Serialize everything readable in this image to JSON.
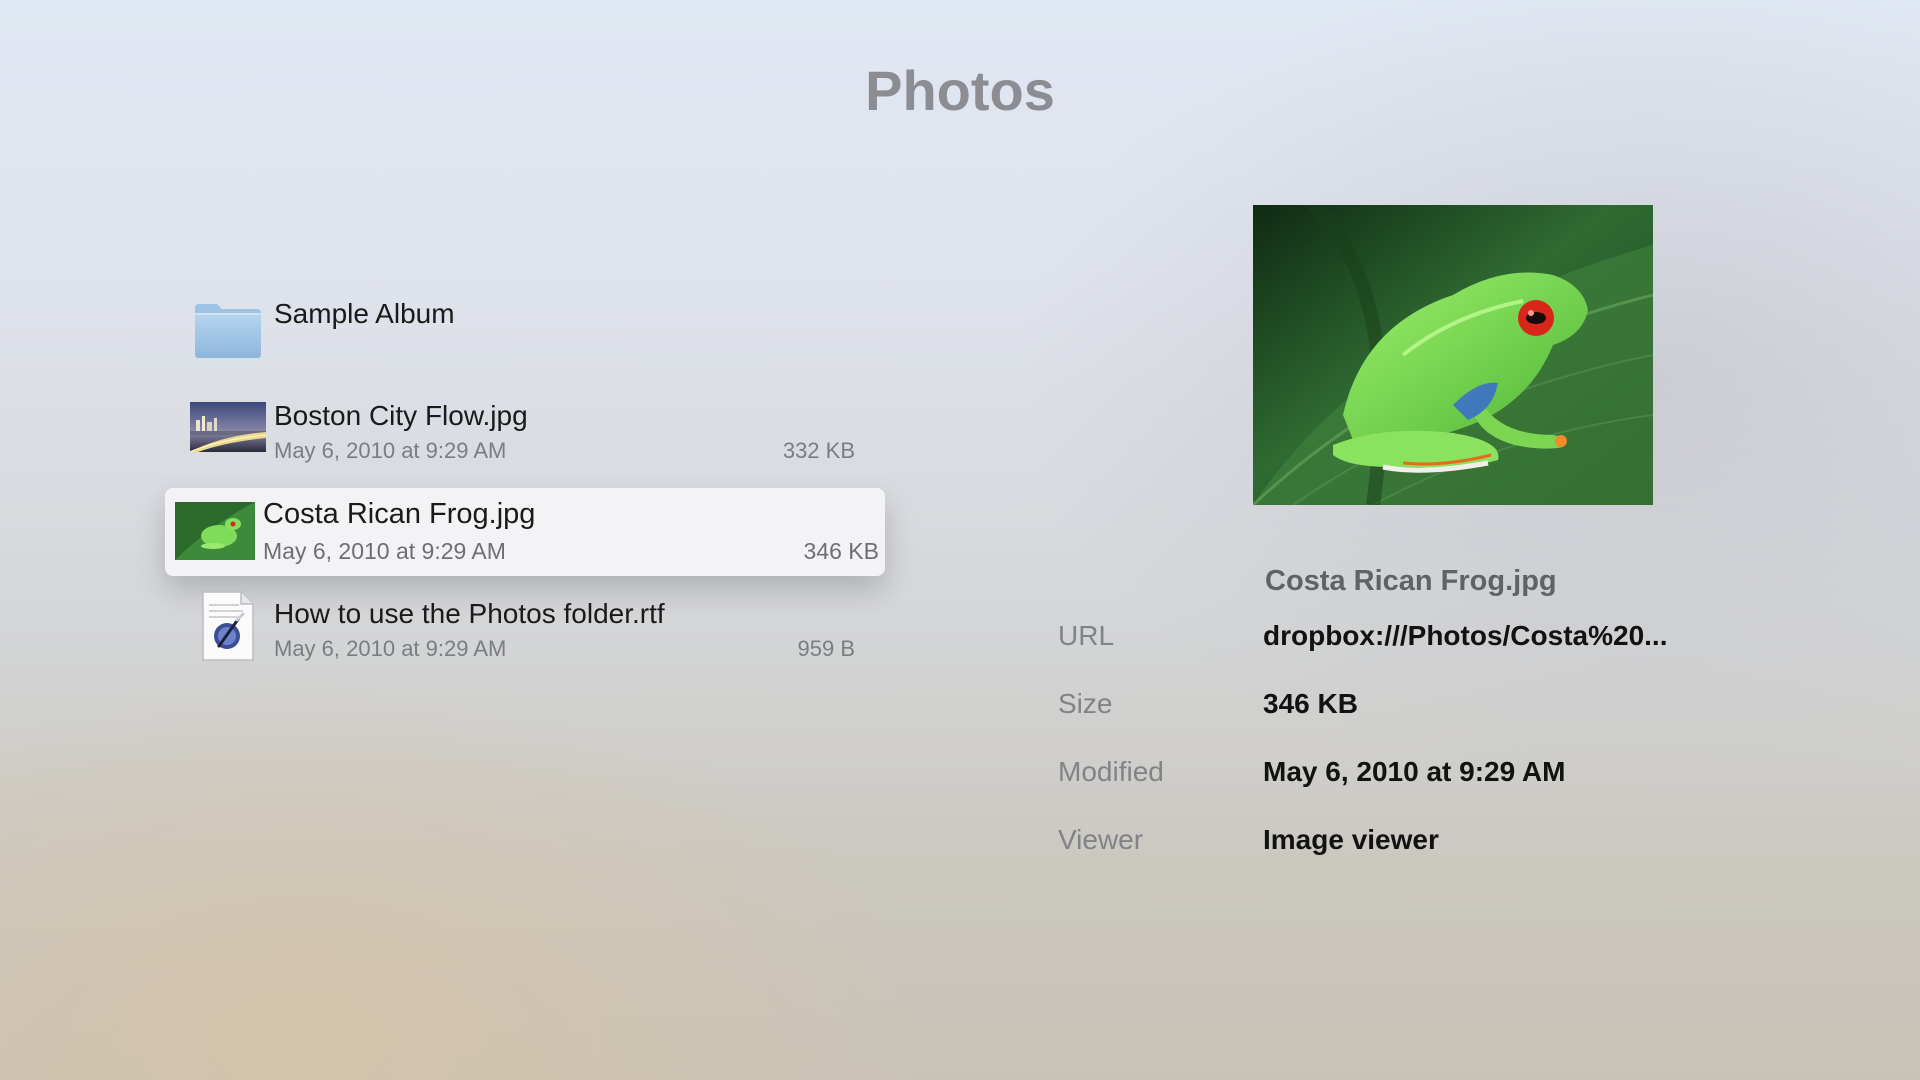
{
  "header": {
    "title": "Photos"
  },
  "files": [
    {
      "name": "Sample Album",
      "date": "",
      "size": "",
      "icon": "folder-icon"
    },
    {
      "name": "Boston City Flow.jpg",
      "date": "May 6, 2010 at 9:29 AM",
      "size": "332 KB",
      "icon": "image-thumbnail"
    },
    {
      "name": "Costa Rican Frog.jpg",
      "date": "May 6, 2010 at 9:29 AM",
      "size": "346 KB",
      "icon": "image-thumbnail",
      "selected": true
    },
    {
      "name": "How to use the Photos folder.rtf",
      "date": "May 6, 2010 at 9:29 AM",
      "size": "959 B",
      "icon": "rtf-document-icon"
    }
  ],
  "preview": {
    "file_name": "Costa Rican Frog.jpg",
    "details": [
      {
        "label": "URL",
        "value": "dropbox:///Photos/Costa%20..."
      },
      {
        "label": "Size",
        "value": "346 KB"
      },
      {
        "label": "Modified",
        "value": "May 6, 2010 at 9:29 AM"
      },
      {
        "label": "Viewer",
        "value": "Image viewer"
      }
    ]
  },
  "colors": {
    "selected_row_bg": "#f3f3f5",
    "title": "#8b8d93",
    "folder": "#9cc3e6"
  }
}
